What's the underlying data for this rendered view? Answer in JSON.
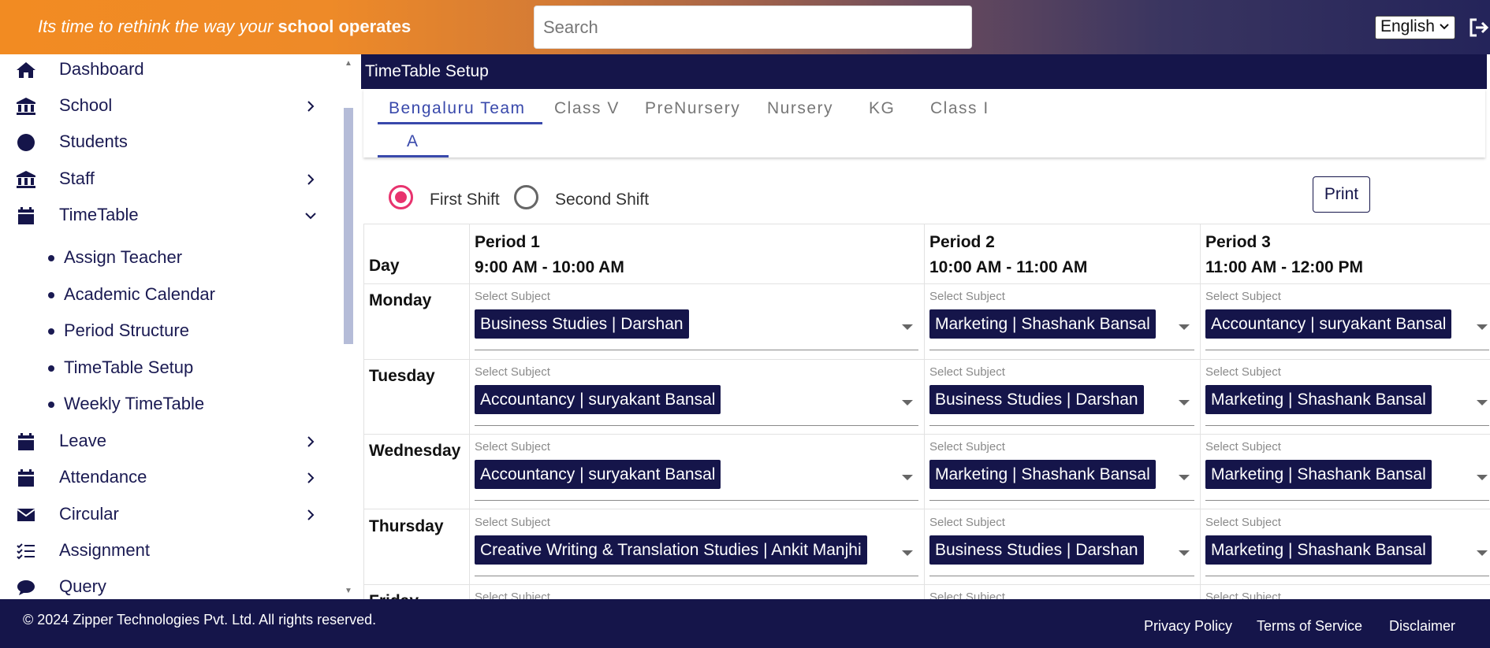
{
  "header": {
    "tagline_prefix": "Its time to rethink the way your ",
    "tagline_bold": "school operates",
    "search_placeholder": "Search",
    "language": "English"
  },
  "sidebar": {
    "items": [
      {
        "label": "Dashboard",
        "icon": "home-icon",
        "arrow": ""
      },
      {
        "label": "School",
        "icon": "bank-icon",
        "arrow": "right"
      },
      {
        "label": "Students",
        "icon": "circle-icon",
        "arrow": ""
      },
      {
        "label": "Staff",
        "icon": "bank-icon",
        "arrow": "right"
      },
      {
        "label": "TimeTable",
        "icon": "calendar-icon",
        "arrow": "down"
      },
      {
        "label": "Leave",
        "icon": "calendar-icon",
        "arrow": "right"
      },
      {
        "label": "Attendance",
        "icon": "calendar-icon",
        "arrow": "right"
      },
      {
        "label": "Circular",
        "icon": "envelope-icon",
        "arrow": "right"
      },
      {
        "label": "Assignment",
        "icon": "checklist-icon",
        "arrow": ""
      },
      {
        "label": "Query",
        "icon": "chat-icon",
        "arrow": ""
      }
    ],
    "timetable_sub": [
      "Assign Teacher",
      "Academic Calendar",
      "Period Structure",
      "TimeTable Setup",
      "Weekly TimeTable"
    ]
  },
  "main": {
    "title": "TimeTable Setup",
    "tabs": [
      "Bengaluru Team",
      "Class V",
      "PreNursery",
      "Nursery",
      "KG",
      "Class I"
    ],
    "subtabs": [
      "A"
    ],
    "shifts": [
      "First Shift",
      "Second Shift"
    ],
    "selected_shift": "First Shift",
    "print_label": "Print",
    "table": {
      "day_header": "Day",
      "cell_hint": "Select Subject",
      "periods": [
        {
          "name": "Period 1",
          "time": "9:00 AM - 10:00 AM"
        },
        {
          "name": "Period 2",
          "time": "10:00 AM - 11:00 AM"
        },
        {
          "name": "Period 3",
          "time": "11:00 AM - 12:00 PM"
        }
      ],
      "rows": [
        {
          "day": "Monday",
          "cells": [
            "Business Studies | Darshan",
            "Marketing | Shashank Bansal",
            "Accountancy | suryakant Bansal"
          ]
        },
        {
          "day": "Tuesday",
          "cells": [
            "Accountancy | suryakant Bansal",
            "Business Studies | Darshan",
            "Marketing | Shashank Bansal"
          ]
        },
        {
          "day": "Wednesday",
          "cells": [
            "Accountancy | suryakant Bansal",
            "Marketing | Shashank Bansal",
            "Marketing | Shashank Bansal"
          ]
        },
        {
          "day": "Thursday",
          "cells": [
            "Creative Writing & Translation Studies | Ankit Manjhi",
            "Business Studies | Darshan",
            "Marketing | Shashank Bansal"
          ]
        },
        {
          "day": "Friday",
          "cells": [
            "",
            "",
            ""
          ]
        }
      ]
    }
  },
  "footer": {
    "copyright": "© 2024 Zipper Technologies Pvt. Ltd. All rights reserved.",
    "links": [
      "Privacy Policy",
      "Terms of Service",
      "Disclaimer"
    ]
  },
  "colors": {
    "navy": "#15154a",
    "header_orange": "#f28b22",
    "tab_active": "#3949ab",
    "radio_active": "#e8336e"
  }
}
